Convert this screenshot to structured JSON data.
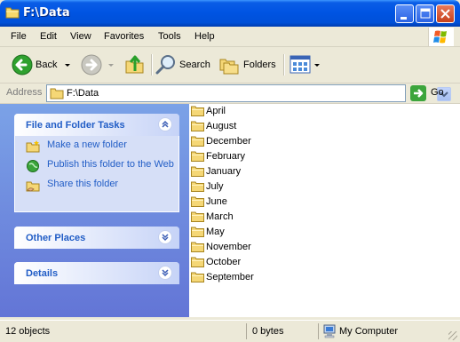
{
  "window": {
    "title": "F:\\Data"
  },
  "menu": {
    "items": [
      "File",
      "Edit",
      "View",
      "Favorites",
      "Tools",
      "Help"
    ]
  },
  "toolbar": {
    "back_label": "Back",
    "search_label": "Search",
    "folders_label": "Folders"
  },
  "address": {
    "label": "Address",
    "value": "F:\\Data",
    "go_label": "Go"
  },
  "taskpane": {
    "file_tasks": {
      "title": "File and Folder Tasks",
      "items": [
        {
          "label": "Make a new folder",
          "icon": "new-folder-icon"
        },
        {
          "label": "Publish this folder to the Web",
          "icon": "publish-web-icon"
        },
        {
          "label": "Share this folder",
          "icon": "share-folder-icon"
        }
      ]
    },
    "other_places": {
      "title": "Other Places"
    },
    "details": {
      "title": "Details"
    }
  },
  "files": [
    "April",
    "August",
    "December",
    "February",
    "January",
    "July",
    "June",
    "March",
    "May",
    "November",
    "October",
    "September"
  ],
  "status": {
    "objects": "12 objects",
    "size": "0 bytes",
    "location": "My Computer"
  },
  "colors": {
    "titlebar": "#0054e3",
    "taskpane": "#7ba2e7",
    "link": "#215dc6",
    "folder": "#f5d776"
  }
}
